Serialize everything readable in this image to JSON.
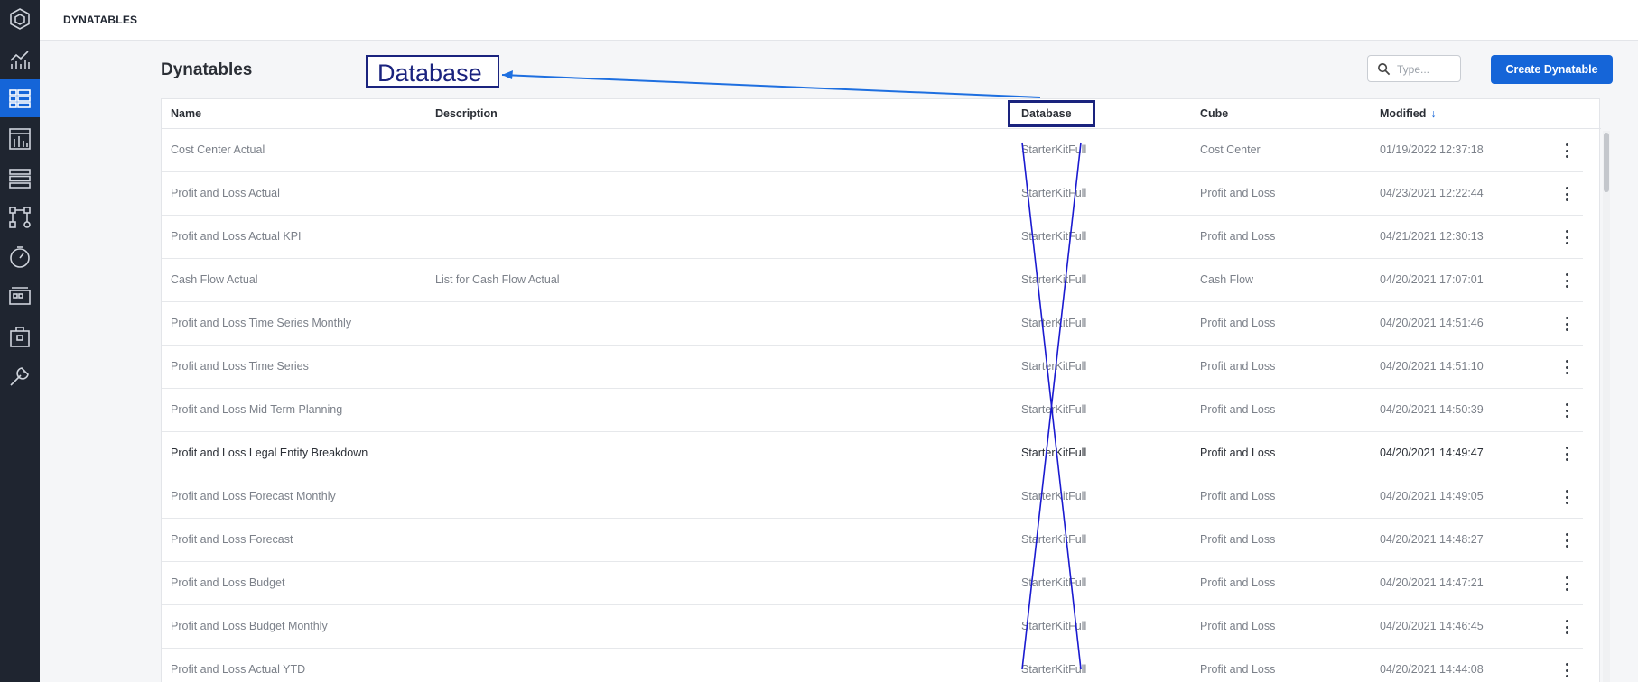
{
  "app": {
    "section_title": "DYNATABLES"
  },
  "nav": {
    "items": [
      {
        "icon": "hexagon-logo-icon"
      },
      {
        "icon": "analytics-icon"
      },
      {
        "icon": "table-grid-icon",
        "active": true
      },
      {
        "icon": "bar-chart-icon"
      },
      {
        "icon": "list-icon"
      },
      {
        "icon": "hierarchy-icon"
      },
      {
        "icon": "dashboard-gauge-icon"
      },
      {
        "icon": "components-icon"
      },
      {
        "icon": "packages-icon"
      },
      {
        "icon": "wrench-icon"
      }
    ]
  },
  "page": {
    "title": "Dynatables",
    "search_placeholder": "Type...",
    "create_button": "Create Dynatable"
  },
  "table": {
    "columns": [
      "Name",
      "Description",
      "Database",
      "Cube",
      "Modified"
    ],
    "sort_column": "Modified",
    "sort_direction": "descending",
    "rows": [
      {
        "name": "Cost Center Actual",
        "description": "",
        "database": "StarterKitFull",
        "cube": "Cost Center",
        "modified": "01/19/2022 12:37:18"
      },
      {
        "name": "Profit and Loss Actual",
        "description": "",
        "database": "StarterKitFull",
        "cube": "Profit and Loss",
        "modified": "04/23/2021 12:22:44"
      },
      {
        "name": "Profit and Loss Actual KPI",
        "description": "",
        "database": "StarterKitFull",
        "cube": "Profit and Loss",
        "modified": "04/21/2021 12:30:13"
      },
      {
        "name": "Cash Flow Actual",
        "description": "List for Cash Flow Actual",
        "database": "StarterKitFull",
        "cube": "Cash Flow",
        "modified": "04/20/2021 17:07:01"
      },
      {
        "name": "Profit and Loss Time Series Monthly",
        "description": "",
        "database": "StarterKitFull",
        "cube": "Profit and Loss",
        "modified": "04/20/2021 14:51:46"
      },
      {
        "name": "Profit and Loss Time Series",
        "description": "",
        "database": "StarterKitFull",
        "cube": "Profit and Loss",
        "modified": "04/20/2021 14:51:10"
      },
      {
        "name": "Profit and Loss Mid Term Planning",
        "description": "",
        "database": "StarterKitFull",
        "cube": "Profit and Loss",
        "modified": "04/20/2021 14:50:39"
      },
      {
        "name": "Profit and Loss Legal Entity Breakdown",
        "description": "",
        "database": "StarterKitFull",
        "cube": "Profit and Loss",
        "modified": "04/20/2021 14:49:47",
        "hovered": true
      },
      {
        "name": "Profit and Loss Forecast Monthly",
        "description": "",
        "database": "StarterKitFull",
        "cube": "Profit and Loss",
        "modified": "04/20/2021 14:49:05"
      },
      {
        "name": "Profit and Loss Forecast",
        "description": "",
        "database": "StarterKitFull",
        "cube": "Profit and Loss",
        "modified": "04/20/2021 14:48:27"
      },
      {
        "name": "Profit and Loss Budget",
        "description": "",
        "database": "StarterKitFull",
        "cube": "Profit and Loss",
        "modified": "04/20/2021 14:47:21"
      },
      {
        "name": "Profit and Loss Budget Monthly",
        "description": "",
        "database": "StarterKitFull",
        "cube": "Profit and Loss",
        "modified": "04/20/2021 14:46:45"
      },
      {
        "name": "Profit and Loss Actual YTD",
        "description": "",
        "database": "StarterKitFull",
        "cube": "Profit and Loss",
        "modified": "04/20/2021 14:44:08"
      }
    ]
  },
  "annotation": {
    "callout_text": "Database",
    "color": "#1a237e",
    "arrow_color": "#1e6fe0"
  },
  "colors": {
    "accent": "#1565d8",
    "rail": "#1f2530"
  }
}
